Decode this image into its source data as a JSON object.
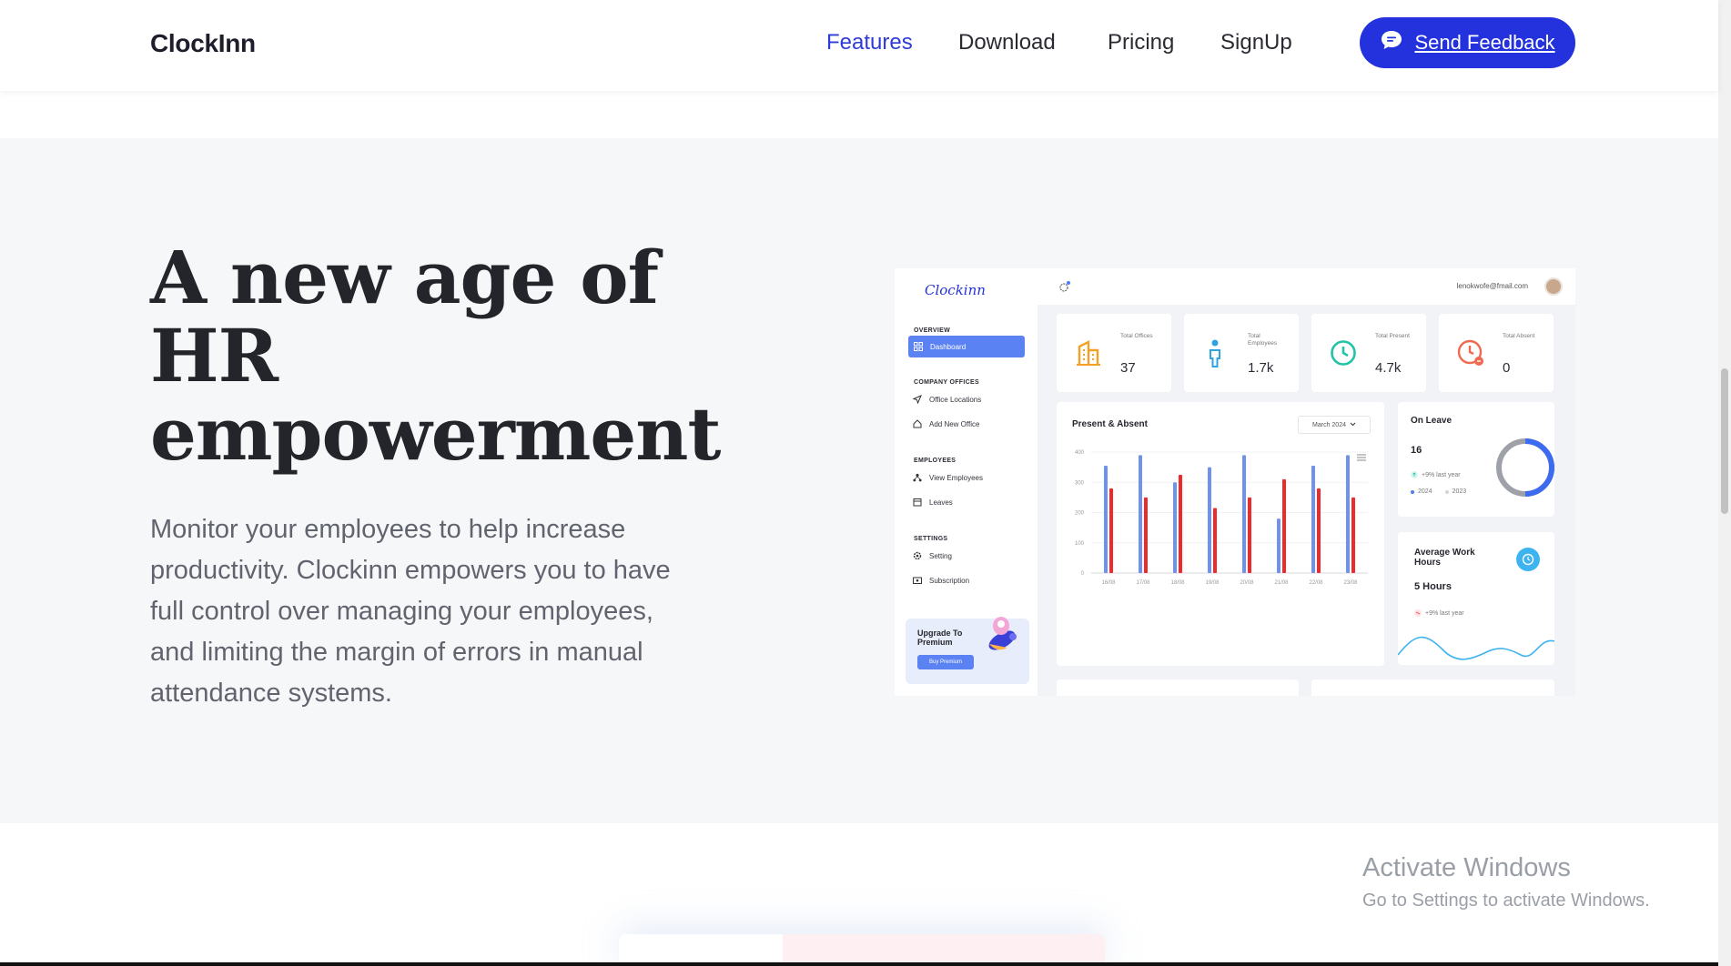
{
  "header": {
    "logo": "ClockInn",
    "nav": [
      "Features",
      "Download",
      "Pricing",
      "SignUp"
    ],
    "feedback_label": "Send Feedback"
  },
  "hero": {
    "title_line1": "A new age of",
    "title_line2": "HR",
    "title_line3": "empowerment",
    "description": "Monitor your employees to help increase productivity. Clockinn empowers you to have full control over managing your employees, and limiting the margin of errors in manual attendance systems."
  },
  "dashboard": {
    "logo": "Clockinn",
    "email": "lenokwofe@fmail.com",
    "sidebar": {
      "overview": "OVERVIEW",
      "dashboard": "Dashboard",
      "company_offices": "COMPANY OFFICES",
      "office_locations": "Office Locations",
      "add_new_office": "Add New Office",
      "employees": "EMPLOYEES",
      "view_employees": "View Employees",
      "leaves": "Leaves",
      "settings": "SETTINGS",
      "setting": "Setting",
      "subscription": "Subscription",
      "upgrade_title": "Upgrade To Premium",
      "upgrade_button": "Buy Premium"
    },
    "stats": [
      {
        "label": "Total Offices",
        "value": "37"
      },
      {
        "label": "Total Employees",
        "value": "1.7k"
      },
      {
        "label": "Total Present",
        "value": "4.7k"
      },
      {
        "label": "Total Absent",
        "value": "0"
      }
    ],
    "present_absent": {
      "title": "Present & Absent",
      "month": "March 2024"
    },
    "on_leave": {
      "title": "On Leave",
      "value": "16",
      "delta": "+9% last year",
      "legend_2024": "2024",
      "legend_2023": "2023"
    },
    "work_hours": {
      "title": "Average Work Hours",
      "value": "5 Hours",
      "delta": "+9% last year"
    },
    "colors": {
      "present": "#6f92ee",
      "absent": "#ee2b2b"
    }
  },
  "chart_data": {
    "type": "bar",
    "title": "Present & Absent",
    "categories": [
      "16/08",
      "17/08",
      "18/08",
      "19/08",
      "20/08",
      "21/08",
      "22/08",
      "23/08"
    ],
    "ylim": [
      0,
      400
    ],
    "yticks": [
      0,
      100,
      200,
      300,
      400
    ],
    "series": [
      {
        "values": [
          355,
          390,
          300,
          350,
          390,
          180,
          355,
          390
        ]
      },
      {
        "values": [
          280,
          250,
          325,
          215,
          250,
          310,
          280,
          250
        ]
      }
    ]
  },
  "watermark": {
    "line1": "Activate Windows",
    "line2": "Go to Settings to activate Windows."
  }
}
